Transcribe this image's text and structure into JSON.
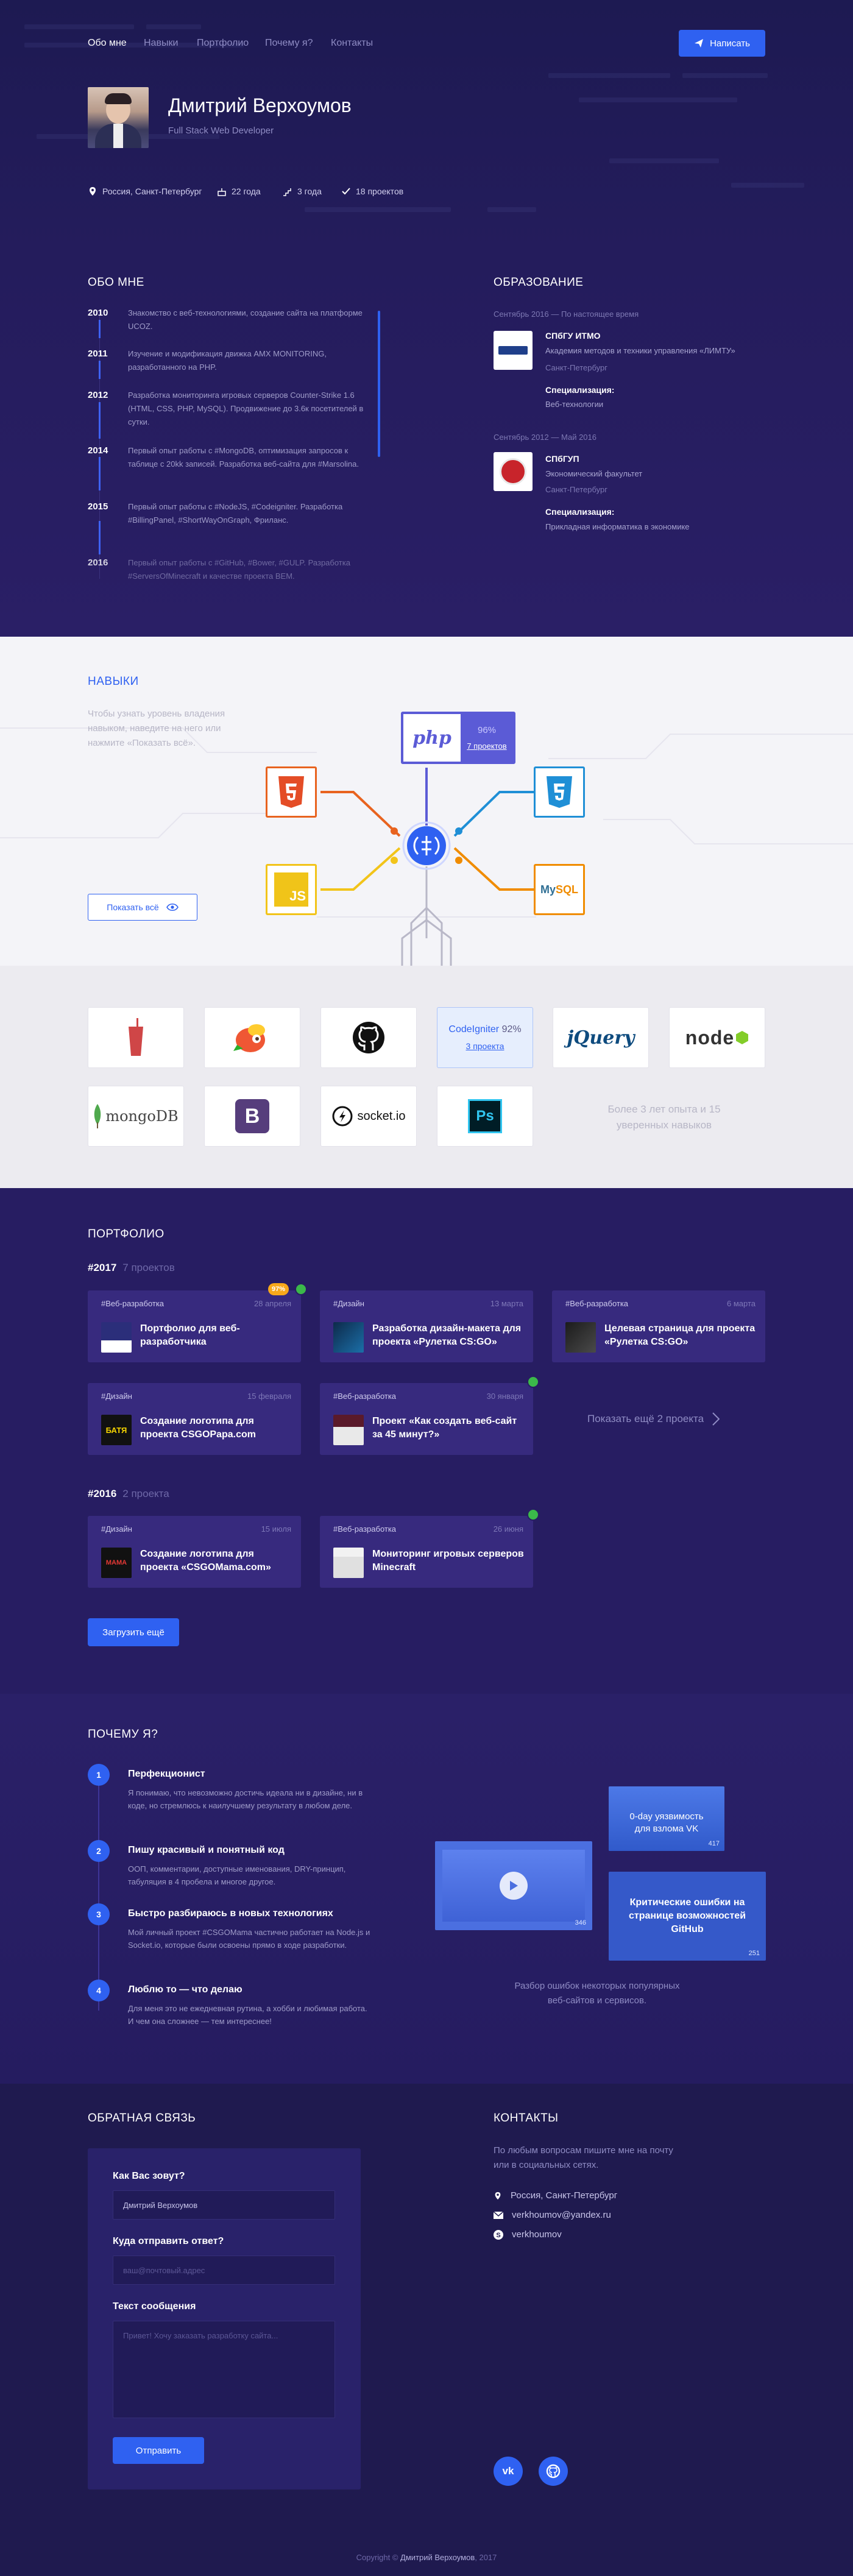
{
  "nav": {
    "items": [
      "Обо мне",
      "Навыки",
      "Портфолио",
      "Почему я?",
      "Контакты"
    ],
    "write_button": "Написать"
  },
  "profile": {
    "name": "Дмитрий Верхоумов",
    "role": "Full Stack Web Developer",
    "location": "Россия, Санкт-Петербург",
    "age": "22 года",
    "experience": "3 года",
    "projects": "18 проектов"
  },
  "about": {
    "title": "ОБО МНЕ",
    "timeline": [
      {
        "year": "2010",
        "text": "Знакомство с веб-технологиями, создание сайта на платформе UCOZ."
      },
      {
        "year": "2011",
        "text": "Изучение и модификация движка AMX MONITORING, разработанного на PHP."
      },
      {
        "year": "2012",
        "text": "Разработка мониторинга игровых серверов Counter-Strike 1.6 (HTML, CSS, PHP, MySQL). Продвижение до 3.6к посетителей в сутки."
      },
      {
        "year": "2014",
        "text": "Первый опыт работы с #MongoDB, оптимизация запросов к таблице с 20kk записей. Разработка веб-сайта для #Marsolina."
      },
      {
        "year": "2015",
        "text": "Первый опыт работы с #NodeJS, #Codeigniter. Разработка #BillingPanel, #ShortWayOnGraph, Фриланс."
      },
      {
        "year": "2016",
        "text": "Первый опыт работы с #GitHub, #Bower, #GULP. Разработка #ServersOfMinecraft и качестве проекта BEM."
      }
    ]
  },
  "education": {
    "title": "ОБРАЗОВАНИЕ",
    "items": [
      {
        "date": "Сентябрь 2016 — По настоящее время",
        "name": "СПбГУ ИТМО",
        "faculty": "Академия методов и техники управления «ЛИМТУ»",
        "city": "Санкт-Петербург",
        "spec_label": "Специализация:",
        "spec": "Веб-технологии"
      },
      {
        "date": "Сентябрь 2012 — Май 2016",
        "name": "СПбГУП",
        "faculty": "Экономический факультет",
        "city": "Санкт-Петербург",
        "spec_label": "Специализация:",
        "spec": "Прикладная информатика в экономике"
      }
    ]
  },
  "skills": {
    "title": "НАВЫКИ",
    "hint": "Чтобы узнать уровень владения навыком, наведите на него или нажмите «Показать всё».",
    "show_all": "Показать всё",
    "php": {
      "label": "php",
      "percent": "96%",
      "projects": "7 проектов"
    },
    "codeigniter": {
      "label": "CodeIgniter",
      "percent": "92%",
      "projects": "3 проекта"
    },
    "tiles_row1": [
      "gulp",
      "bower",
      "github",
      "CodeIgniter",
      "jQuery",
      "node"
    ],
    "tiles_row2": [
      "mongoDB",
      "bootstrap",
      "socket.io",
      "Ps"
    ],
    "summary": "Более 3 лет опыта и 15 уверенных навыков"
  },
  "portfolio": {
    "title": "ПОРТФОЛИО",
    "y2017": {
      "year": "#2017",
      "count": "7 проектов"
    },
    "y2016": {
      "year": "#2016",
      "count": "2 проекта"
    },
    "cards2017": [
      {
        "tag": "#Веб-разработка",
        "date": "28 апреля",
        "title": "Портфолио для веб-разработчика",
        "badge": "97%"
      },
      {
        "tag": "#Дизайн",
        "date": "13 марта",
        "title": "Разработка дизайн-макета для проекта «Рулетка CS:GO»"
      },
      {
        "tag": "#Веб-разработка",
        "date": "6 марта",
        "title": "Целевая страница для проекта «Рулетка CS:GO»"
      },
      {
        "tag": "#Дизайн",
        "date": "15 февраля",
        "title": "Создание логотипа для проекта CSGOPapa.com"
      },
      {
        "tag": "#Веб-разработка",
        "date": "30 января",
        "title": "Проект «Как создать веб-сайт за 45 минут?»"
      }
    ],
    "show_more": "Показать ещё 2 проекта",
    "cards2016": [
      {
        "tag": "#Дизайн",
        "date": "15 июля",
        "title": "Создание логотипа для проекта «CSGOMama.com»"
      },
      {
        "tag": "#Веб-разработка",
        "date": "26 июня",
        "title": "Мониторинг игровых серверов Minecraft"
      }
    ],
    "load_more": "Загрузить ещё"
  },
  "why": {
    "title": "ПОЧЕМУ Я?",
    "items": [
      {
        "num": "1",
        "title": "Перфекционист",
        "text": "Я понимаю, что невозможно достичь идеала ни в дизайне, ни в коде, но стремлюсь к наилучшему результату в любом деле."
      },
      {
        "num": "2",
        "title": "Пишу красивый и понятный код",
        "text": "ООП, комментарии, доступные именования, DRY-принцип, табуляция в 4 пробела и многое другое."
      },
      {
        "num": "3",
        "title": "Быстро разбираюсь в новых технологиях",
        "text": "Мой личный проект #CSGOMama частично работает на Node.js и Socket.io, которые были освоены прямо в ходе разработки."
      },
      {
        "num": "4",
        "title": "Люблю то — что делаю",
        "text": "Для меня это не ежедневная рутина, а хобби и любимая работа. И чем она сложнее — тем интереснее!"
      }
    ],
    "cases": [
      {
        "title": "0-day уязвимость для взлома VK",
        "views": "417"
      },
      {
        "title": "",
        "views": "346"
      },
      {
        "title": "Критические ошибки на странице возможностей GitHub",
        "views": "251"
      }
    ],
    "caption": "Разбор ошибок некоторых популярных веб-сайтов и сервисов."
  },
  "feedback": {
    "title": "ОБРАТНАЯ СВЯЗЬ",
    "name_label": "Как Вас зовут?",
    "name_value": "Дмитрий Верхоумов",
    "reply_label": "Куда отправить ответ?",
    "reply_placeholder": "ваш@почтовый.адрес",
    "msg_label": "Текст сообщения",
    "msg_placeholder": "Привет! Хочу заказать разработку сайта...",
    "send": "Отправить"
  },
  "contacts": {
    "title": "КОНТАКТЫ",
    "intro": "По любым вопросам пишите мне на почту или в социальных сетях.",
    "location": "Россия, Санкт-Петербург",
    "email": "verkhoumov@yandex.ru",
    "skype": "verkhoumov"
  },
  "footer": {
    "prefix": "Copyright ©",
    "name": "Дмитрий Верхоумов",
    "year": ", 2017"
  },
  "colors": {
    "accent": "#2f61f1",
    "bg_dark": "#231a5b",
    "html": "#e44d26",
    "css": "#1f8fd6",
    "js": "#f0c419",
    "mysql": "#f08c00"
  }
}
